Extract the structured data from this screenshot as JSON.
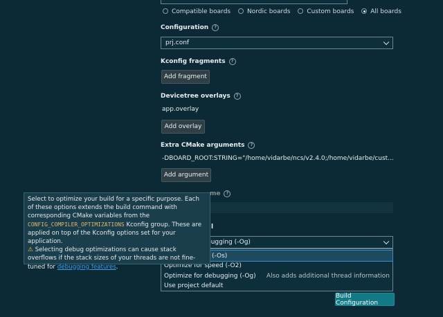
{
  "boards": {
    "options": [
      {
        "label": "Compatible boards",
        "selected": false
      },
      {
        "label": "Nordic boards",
        "selected": false
      },
      {
        "label": "Custom boards",
        "selected": false
      },
      {
        "label": "All boards",
        "selected": true
      }
    ]
  },
  "configuration": {
    "label": "Configuration",
    "value": "prj.conf"
  },
  "kconfig": {
    "label": "Kconfig fragments",
    "button": "Add fragment"
  },
  "devicetree": {
    "label": "Devicetree overlays",
    "item": "app.overlay",
    "button": "Add overlay"
  },
  "cmake": {
    "label": "Extra CMake arguments",
    "value": "-DBOARD_ROOT:STRING=\"/home/vidarbe/ncs/v2.4.0;/home/vidarbe/cust…",
    "button": "Add argument"
  },
  "hidden_labels": {
    "build_dir_suffix": "me",
    "optimization_suffix": "l"
  },
  "tooltip": {
    "text1": "Select to optimize your build for a specific purpose. Each of these options extends the build command with corresponding CMake variables from the",
    "code": "CONFIG_COMPILER_OPTIMIZATIONS",
    "text2": "Kconfig group. These are applied on top of the Kconfig options set for your application.",
    "warning": "Selecting debug optimizations can cause stack overflows if the stack sizes of your threads are not fine-tuned for",
    "link": "debugging features",
    "end": "."
  },
  "optimization": {
    "selected_visible": "bugging (-Og)",
    "options": [
      {
        "label": "(-Os)",
        "desc": ""
      },
      {
        "label": "Optimize for speed (-O2)",
        "desc": ""
      },
      {
        "label": "Optimize for debugging (-Og)",
        "desc": "Also adds additional thread information"
      },
      {
        "label": "Use project default",
        "desc": ""
      }
    ]
  },
  "build_button": "Build Configuration",
  "colors": {
    "background": "#0b2a35",
    "accent": "#127a87",
    "link": "#3aa0f0",
    "warning": "#e5c04a"
  }
}
